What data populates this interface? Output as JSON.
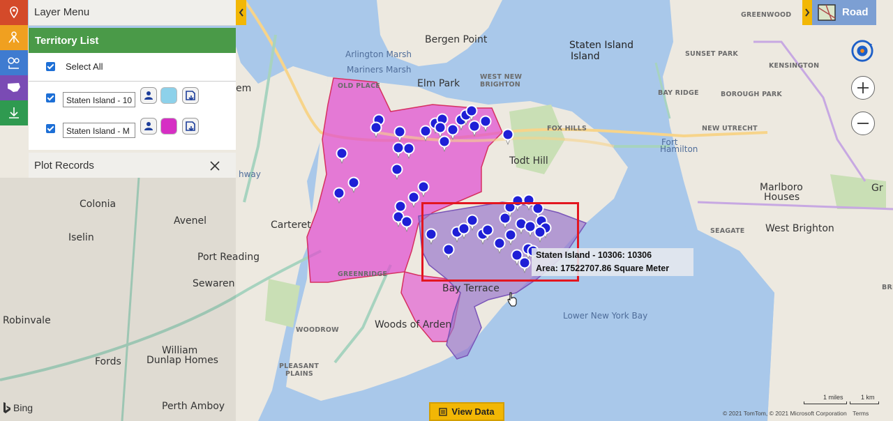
{
  "layer_menu": {
    "title": "Layer Menu"
  },
  "territory_list": {
    "title": "Territory List",
    "select_all_label": "Select All",
    "items": [
      {
        "name": "Staten Island - 10",
        "color": "#8dd1ea"
      },
      {
        "name": "Staten Island - M",
        "color": "#d62ec4"
      }
    ]
  },
  "plot_records": {
    "title": "Plot Records"
  },
  "map_type": {
    "label": "Road"
  },
  "tooltip": {
    "line1": "Staten Island - 10306: 10306",
    "line2": "Area: 17522707.86 Square Meter"
  },
  "view_data": {
    "label": "View Data"
  },
  "branding": {
    "bing": "Bing"
  },
  "attribution": {
    "copyright": "© 2021 TomTom, © 2021 Microsoft Corporation",
    "terms": "Terms"
  },
  "scale": {
    "miles": "1 miles",
    "km": "1 km"
  },
  "colors": {
    "rail_red": "#d44a2a",
    "rail_orange": "#f0a020",
    "rail_blue": "#3f7bd0",
    "rail_purple": "#7a4bb4",
    "rail_green": "#2f9a50",
    "territory_pink": "#e04ed0",
    "territory_purple": "#9a78cc",
    "pin_blue": "#1f1fd6",
    "accent_yellow": "#f2b705"
  },
  "map_labels": [
    {
      "text": "Staten Island",
      "cls": "ml-city"
    },
    {
      "text": "Island",
      "cls": "ml-city"
    },
    {
      "text": "Bergen Point",
      "cls": "ml-lg"
    },
    {
      "text": "Arlington Marsh",
      "cls": "ml-water"
    },
    {
      "text": "Mariners Marsh",
      "cls": "ml-water"
    },
    {
      "text": "Elm Park",
      "cls": "ml-lg"
    },
    {
      "text": "OLD PLACE",
      "cls": "ml-sm"
    },
    {
      "text": "WEST NEW",
      "cls": "ml-sm"
    },
    {
      "text": "BRIGHTON",
      "cls": "ml-sm"
    },
    {
      "text": "FOX HILLS",
      "cls": "ml-sm"
    },
    {
      "text": "Todt Hill",
      "cls": "ml-lg"
    },
    {
      "text": "GREENWOOD",
      "cls": "ml-sm"
    },
    {
      "text": "SUNSET PARK",
      "cls": "ml-sm"
    },
    {
      "text": "KENSINGTON",
      "cls": "ml-sm"
    },
    {
      "text": "BAY RIDGE",
      "cls": "ml-sm"
    },
    {
      "text": "BOROUGH PARK",
      "cls": "ml-sm"
    },
    {
      "text": "NEW UTRECHT",
      "cls": "ml-sm"
    },
    {
      "text": "Fort",
      "cls": "ml-water"
    },
    {
      "text": "Hamilton",
      "cls": "ml-water"
    },
    {
      "text": "Marlboro",
      "cls": "ml-lg"
    },
    {
      "text": "Houses",
      "cls": "ml-lg"
    },
    {
      "text": "SEAGATE",
      "cls": "ml-sm"
    },
    {
      "text": "West Brighton",
      "cls": "ml-lg"
    },
    {
      "text": "Gr",
      "cls": "ml-lg"
    },
    {
      "text": "BREEZY P",
      "cls": "ml-sm"
    },
    {
      "text": "Lower New York Bay",
      "cls": "ml-water"
    },
    {
      "text": "Bay Terrace",
      "cls": "ml-lg"
    },
    {
      "text": "GREENRIDGE",
      "cls": "ml-sm"
    },
    {
      "text": "Woods of Arden",
      "cls": "ml-lg"
    },
    {
      "text": "WOODROW",
      "cls": "ml-sm"
    },
    {
      "text": "PLEASANT",
      "cls": "ml-sm"
    },
    {
      "text": "PLAINS",
      "cls": "ml-sm"
    },
    {
      "text": "Carteret",
      "cls": "ml-lg"
    },
    {
      "text": "Colonia",
      "cls": "ml-lg"
    },
    {
      "text": "Iselin",
      "cls": "ml-lg"
    },
    {
      "text": "Avenel",
      "cls": "ml-lg"
    },
    {
      "text": "Port Reading",
      "cls": "ml-lg"
    },
    {
      "text": "Sewaren",
      "cls": "ml-lg"
    },
    {
      "text": "Robinvale",
      "cls": "ml-lg"
    },
    {
      "text": "Fords",
      "cls": "ml-lg"
    },
    {
      "text": "William",
      "cls": "ml-lg"
    },
    {
      "text": "Dunlap Homes",
      "cls": "ml-lg"
    },
    {
      "text": "Perth Amboy",
      "cls": "ml-lg"
    },
    {
      "text": "em",
      "cls": "ml-lg"
    },
    {
      "text": "hway",
      "cls": "ml-water"
    }
  ]
}
